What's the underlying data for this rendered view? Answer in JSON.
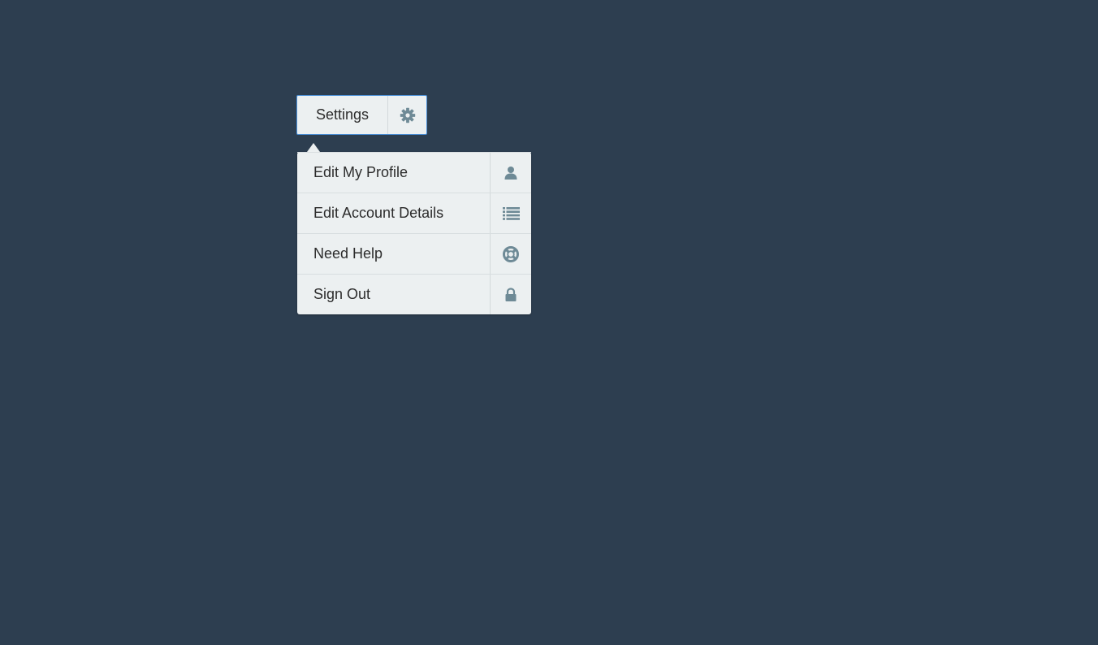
{
  "colors": {
    "background": "#2d3e50",
    "panel": "#ecf0f1",
    "icon": "#6e8a96",
    "focus_border": "#4a90d9"
  },
  "settings": {
    "label": "Settings",
    "icon": "gear-icon"
  },
  "menu": {
    "items": [
      {
        "label": "Edit My Profile",
        "icon": "user-icon"
      },
      {
        "label": "Edit Account Details",
        "icon": "list-icon"
      },
      {
        "label": "Need Help",
        "icon": "lifebuoy-icon"
      },
      {
        "label": "Sign Out",
        "icon": "lock-icon"
      }
    ]
  }
}
